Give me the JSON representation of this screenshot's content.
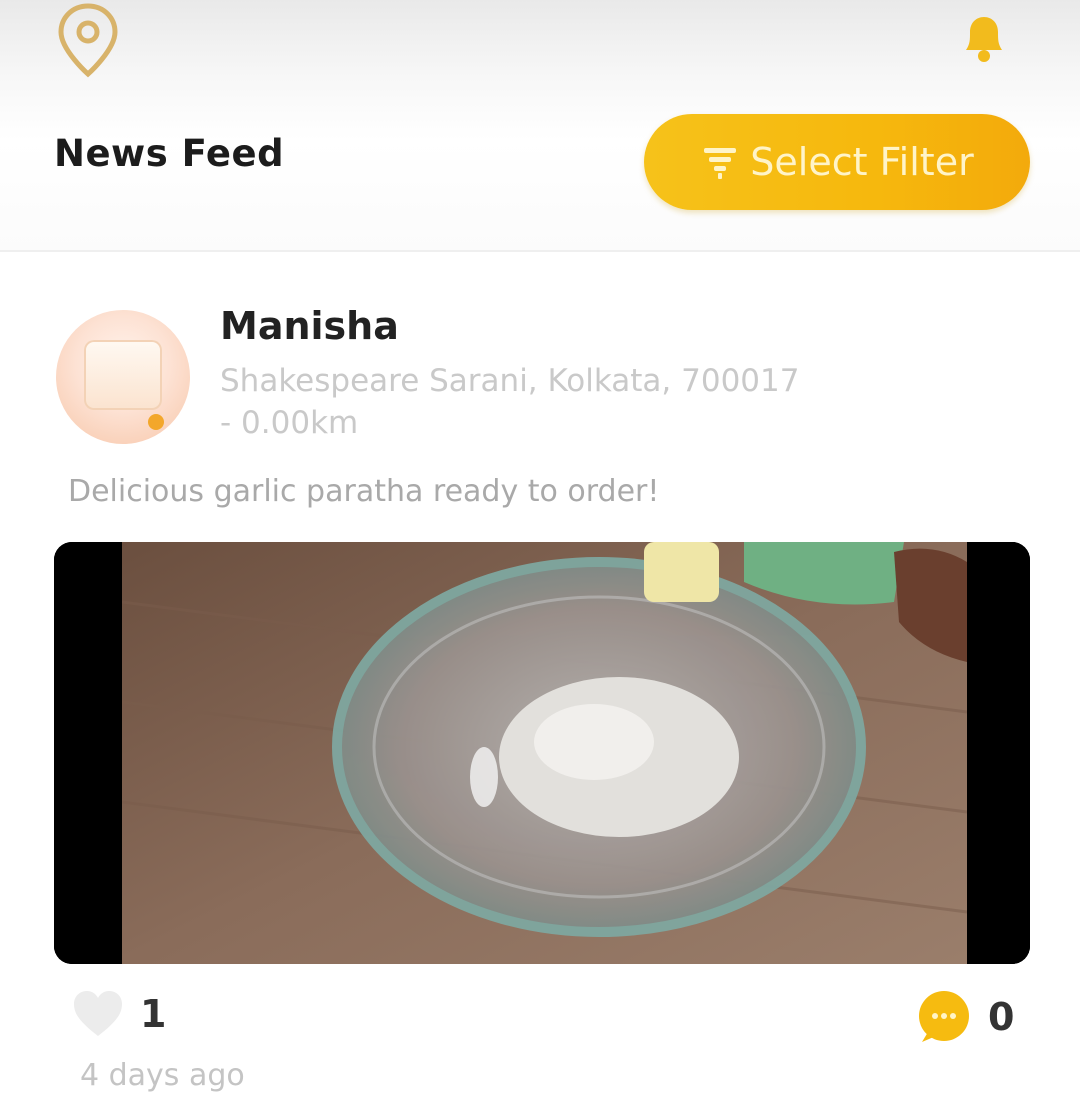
{
  "header": {
    "title": "News Feed",
    "filter_label": "Select Filter",
    "icons": {
      "location": "location-pin-icon",
      "notifications": "bell-icon",
      "filter": "filter-icon"
    },
    "accent_color": "#f6bb10"
  },
  "post": {
    "author": "Manisha",
    "address": "Shakespeare Sarani, Kolkata, 700017",
    "distance": "- 0.00km",
    "caption": "Delicious garlic paratha ready to order!",
    "likes": "1",
    "comments": "0",
    "time_ago": "4 days ago",
    "icons": {
      "like": "heart-icon",
      "comment": "chat-bubble-icon"
    }
  }
}
